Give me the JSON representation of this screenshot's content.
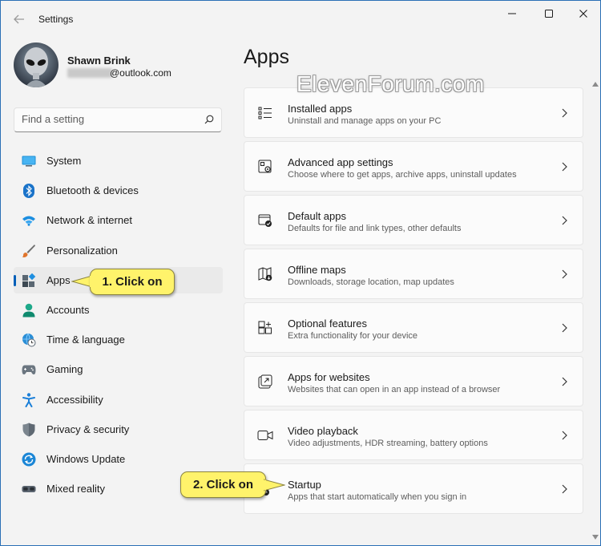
{
  "window": {
    "title": "Settings",
    "controls": [
      "minimize-icon",
      "maximize-icon",
      "close-icon"
    ]
  },
  "profile": {
    "name": "Shawn Brink",
    "email_suffix": "@outlook.com"
  },
  "search": {
    "placeholder": "Find a setting"
  },
  "sidebar": {
    "items": [
      {
        "label": "System",
        "icon": "system-icon",
        "selected": false
      },
      {
        "label": "Bluetooth & devices",
        "icon": "bluetooth-icon",
        "selected": false
      },
      {
        "label": "Network & internet",
        "icon": "wifi-icon",
        "selected": false
      },
      {
        "label": "Personalization",
        "icon": "brush-icon",
        "selected": false
      },
      {
        "label": "Apps",
        "icon": "apps-icon",
        "selected": true
      },
      {
        "label": "Accounts",
        "icon": "accounts-icon",
        "selected": false
      },
      {
        "label": "Time & language",
        "icon": "globe-clock-icon",
        "selected": false
      },
      {
        "label": "Gaming",
        "icon": "gamepad-icon",
        "selected": false
      },
      {
        "label": "Accessibility",
        "icon": "accessibility-icon",
        "selected": false
      },
      {
        "label": "Privacy & security",
        "icon": "shield-icon",
        "selected": false
      },
      {
        "label": "Windows Update",
        "icon": "update-icon",
        "selected": false
      },
      {
        "label": "Mixed reality",
        "icon": "headset-icon",
        "selected": false
      }
    ]
  },
  "main": {
    "title": "Apps",
    "watermark": "ElevenForum.com",
    "cards": [
      {
        "title": "Installed apps",
        "subtitle": "Uninstall and manage apps on your PC",
        "icon": "list-icon"
      },
      {
        "title": "Advanced app settings",
        "subtitle": "Choose where to get apps, archive apps, uninstall updates",
        "icon": "app-settings-icon"
      },
      {
        "title": "Default apps",
        "subtitle": "Defaults for file and link types, other defaults",
        "icon": "default-apps-icon"
      },
      {
        "title": "Offline maps",
        "subtitle": "Downloads, storage location, map updates",
        "icon": "map-icon"
      },
      {
        "title": "Optional features",
        "subtitle": "Extra functionality for your device",
        "icon": "add-grid-icon"
      },
      {
        "title": "Apps for websites",
        "subtitle": "Websites that can open in an app instead of a browser",
        "icon": "open-in-app-icon"
      },
      {
        "title": "Video playback",
        "subtitle": "Video adjustments, HDR streaming, battery options",
        "icon": "video-icon"
      },
      {
        "title": "Startup",
        "subtitle": "Apps that start automatically when you sign in",
        "icon": "startup-icon"
      }
    ]
  },
  "callouts": {
    "step1": "1. Click on",
    "step2": "2. Click on"
  },
  "colors": {
    "accent": "#005fb8",
    "callout": "#fff36b",
    "window_bg": "#f3f3f3",
    "card_bg": "#fbfbfb"
  }
}
